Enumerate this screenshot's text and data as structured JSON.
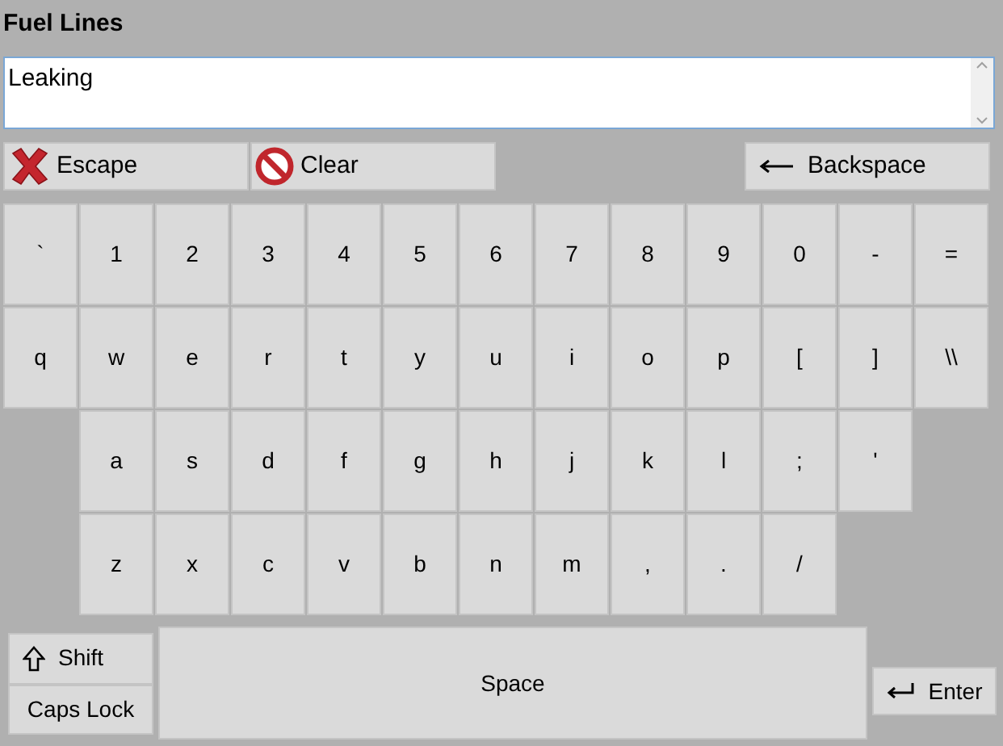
{
  "title": "Fuel Lines",
  "field": {
    "value": "Leaking"
  },
  "actions": [
    {
      "kind": "escape",
      "label": "Escape"
    },
    {
      "kind": "clear",
      "label": "Clear"
    },
    {
      "kind": "backspace",
      "label": "Backspace"
    }
  ],
  "key_rows": [
    [
      "`",
      "1",
      "2",
      "3",
      "4",
      "5",
      "6",
      "7",
      "8",
      "9",
      "0",
      "-",
      "="
    ],
    [
      "q",
      "w",
      "e",
      "r",
      "t",
      "y",
      "u",
      "i",
      "o",
      "p",
      "[",
      "]",
      "\\\\"
    ],
    [
      "a",
      "s",
      "d",
      "f",
      "g",
      "h",
      "j",
      "k",
      "l",
      ";",
      "'"
    ],
    [
      "z",
      "x",
      "c",
      "v",
      "b",
      "n",
      "m",
      ",",
      ".",
      "/"
    ]
  ],
  "bottom_keys": [
    {
      "kind": "shift",
      "label": "Shift"
    },
    {
      "kind": "caps",
      "label": "Caps Lock"
    },
    {
      "kind": "space",
      "label": "Space"
    },
    {
      "kind": "enter",
      "label": "Enter"
    }
  ]
}
